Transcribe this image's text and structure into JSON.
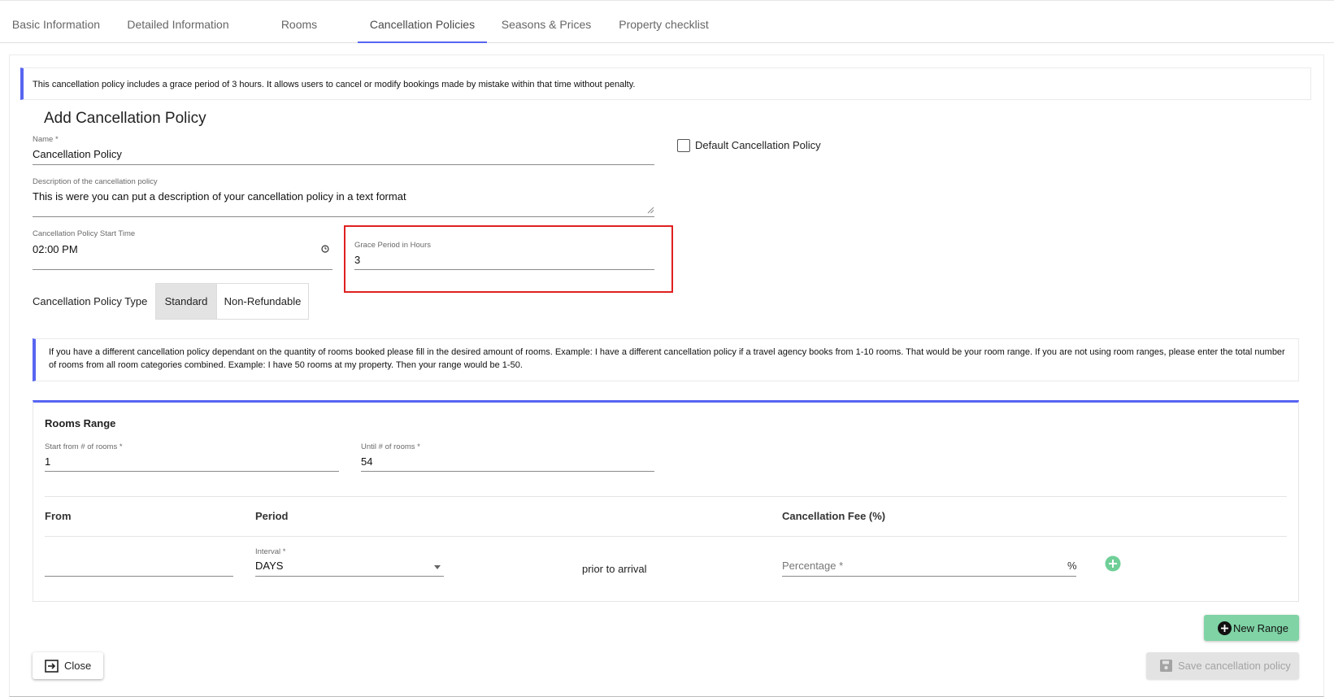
{
  "tabs": [
    {
      "label": "Basic Information"
    },
    {
      "label": "Detailed Information"
    },
    {
      "label": "Rooms"
    },
    {
      "label": "Cancellation Policies"
    },
    {
      "label": "Seasons & Prices"
    },
    {
      "label": "Property checklist"
    }
  ],
  "active_tab": "Cancellation Policies",
  "info_alert": "This cancellation policy includes a grace period of 3 hours. It allows users to cancel or modify bookings made by mistake within that time without penalty.",
  "form": {
    "title": "Add Cancellation Policy",
    "name_label": "Name *",
    "name_value": "Cancellation Policy",
    "default_label": "Default Cancellation Policy",
    "default_checked": false,
    "description_label": "Description of the cancellation policy",
    "description_value": "This is were you can put a description of your cancellation policy in a text format",
    "start_time_label": "Cancellation Policy Start Time",
    "start_time_value": "02:00 PM",
    "grace_label": "Grace Period in Hours",
    "grace_value": "3",
    "type_label": "Cancellation Policy Type",
    "type_options": [
      "Standard",
      "Non-Refundable"
    ],
    "type_selected": "Standard"
  },
  "rooms_alert": "If you have a different cancellation policy dependant on the quantity of rooms booked please fill in the desired amount of rooms. Example: I have a different cancellation policy if a travel agency books from 1-10 rooms. That would be your room range. If you are not using room ranges, please enter the total number of rooms from all room categories combined. Example: I have 50 rooms at my property. Then your range would be 1-50.",
  "range": {
    "title": "Rooms Range",
    "start_label": "Start from # of rooms *",
    "start_value": "1",
    "until_label": "Until # of rooms *",
    "until_value": "54",
    "headers": {
      "from": "From",
      "period": "Period",
      "fee": "Cancellation Fee (%)"
    },
    "interval_label": "Interval *",
    "interval_value": "DAYS",
    "prior_text": "prior to arrival",
    "percentage_placeholder": "Percentage *",
    "percent_suffix": "%"
  },
  "buttons": {
    "new_range": "New Range",
    "close": "Close",
    "save": "Save cancellation policy"
  },
  "colors": {
    "accent": "#5865f2",
    "success": "#7fd3a5",
    "highlight": "#e02020",
    "add_icon": "#6fcf97"
  }
}
